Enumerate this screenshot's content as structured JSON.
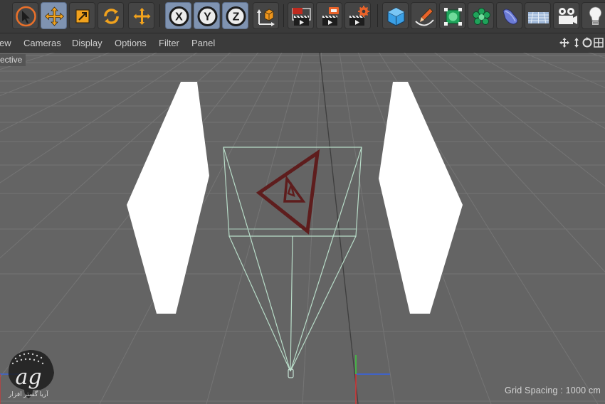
{
  "toolbar": {
    "groups": [
      {
        "name": "select-tools",
        "items": [
          "select-arrow-icon",
          "move-icon",
          "scale-icon",
          "rotate-icon",
          "move-combo-icon"
        ]
      },
      {
        "name": "axis-lock",
        "items": [
          {
            "icon": "x-axis-icon",
            "label": "X"
          },
          {
            "icon": "y-axis-icon",
            "label": "Y"
          },
          {
            "icon": "z-axis-icon",
            "label": "Z"
          },
          {
            "icon": "coordinate-system-icon",
            "label": ""
          }
        ]
      },
      {
        "name": "render",
        "items": [
          "render-view-icon",
          "render-picture-viewer-icon",
          "render-settings-icon"
        ]
      },
      {
        "name": "objects",
        "items": [
          "cube-icon",
          "pen-spline-icon",
          "subdivision-icon",
          "cloner-icon",
          "deformer-icon",
          "floor-icon",
          "camera-icon",
          "light-icon"
        ]
      }
    ]
  },
  "menu": {
    "items": [
      "View",
      "Cameras",
      "Display",
      "Options",
      "Filter",
      "Panel"
    ],
    "visible_first": "ew"
  },
  "viewport": {
    "label": "ective",
    "grid_spacing": "Grid Spacing : 1000 cm",
    "background": "#636363",
    "grid_color": "#767676"
  },
  "watermark": {
    "text": "آریا گستر افزار",
    "logo": "ag"
  }
}
